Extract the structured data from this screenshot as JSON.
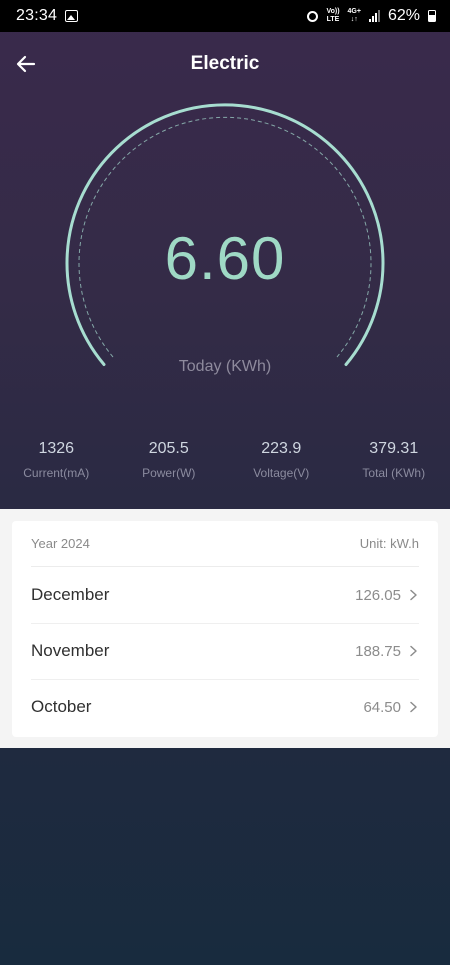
{
  "status_bar": {
    "time": "23:34",
    "network_label_top": "Vo))",
    "network_label_bottom": "LTE",
    "data_label_top": "4G+",
    "data_label_bottom": "↓↑",
    "battery": "62%"
  },
  "header": {
    "title": "Electric",
    "back_icon": "arrow-left-icon"
  },
  "gauge": {
    "value": "6.60",
    "label": "Today (KWh)",
    "color": "#9fd9c5"
  },
  "stats": [
    {
      "value": "1326",
      "label": "Current(mA)"
    },
    {
      "value": "205.5",
      "label": "Power(W)"
    },
    {
      "value": "223.9",
      "label": "Voltage(V)"
    },
    {
      "value": "379.31",
      "label": "Total (KWh)"
    }
  ],
  "history": {
    "year_label": "Year 2024",
    "unit_label": "Unit: kW.h",
    "months": [
      {
        "name": "December",
        "value": "126.05"
      },
      {
        "name": "November",
        "value": "188.75"
      },
      {
        "name": "October",
        "value": "64.50"
      }
    ]
  }
}
